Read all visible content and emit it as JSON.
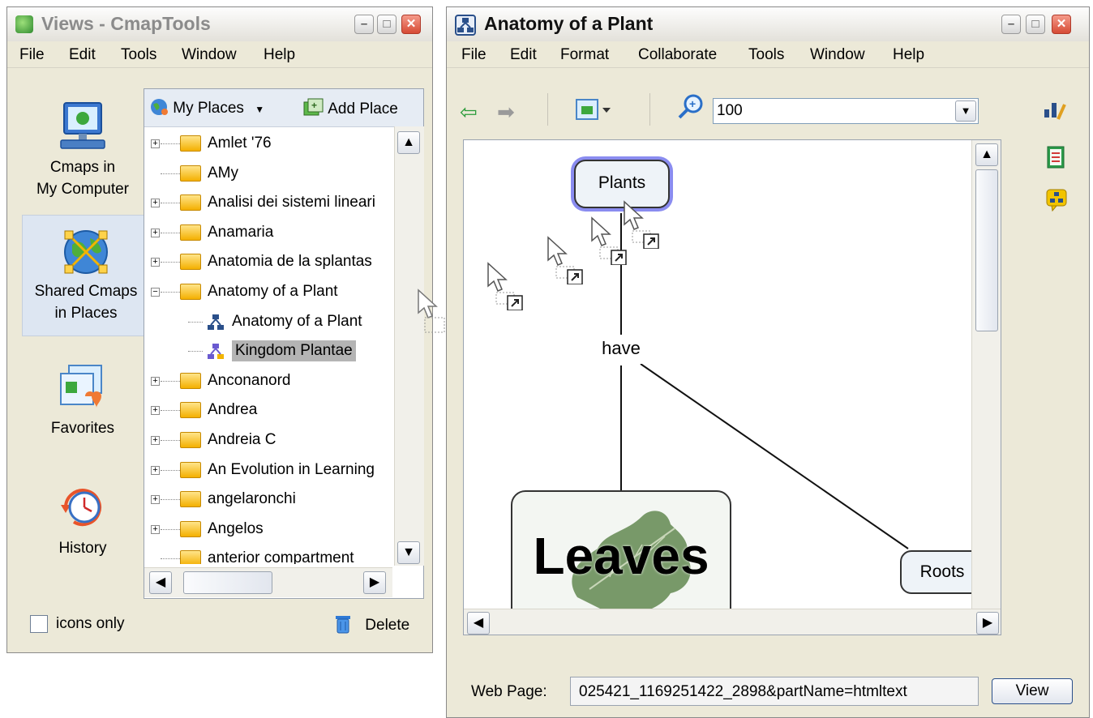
{
  "views_window": {
    "title": "Views - CmapTools",
    "menu": [
      "File",
      "Edit",
      "Tools",
      "Window",
      "Help"
    ],
    "nav": [
      {
        "label_line1": "Cmaps in",
        "label_line2": "My Computer",
        "icon": "computer-icon"
      },
      {
        "label_line1": "Shared Cmaps",
        "label_line2": "in Places",
        "icon": "globe-network-icon"
      },
      {
        "label_line1": "Favorites",
        "label_line2": "",
        "icon": "favorites-icon"
      },
      {
        "label_line1": "History",
        "label_line2": "",
        "icon": "history-clock-icon"
      }
    ],
    "places_button": "My Places",
    "add_place_button": "Add Place",
    "tree": [
      {
        "label": "Amlet '76",
        "type": "folder",
        "expander": "+"
      },
      {
        "label": "AMy",
        "type": "folder",
        "expander": ""
      },
      {
        "label": "Analisi dei sistemi lineari",
        "type": "folder",
        "expander": "+"
      },
      {
        "label": "Anamaria",
        "type": "folder",
        "expander": "+"
      },
      {
        "label": "Anatomia de la splantas",
        "type": "folder",
        "expander": "+"
      },
      {
        "label": "Anatomy of a Plant",
        "type": "folder-open",
        "expander": "−"
      },
      {
        "label": "Anatomy of a Plant",
        "type": "cmap",
        "expander": ""
      },
      {
        "label": "Kingdom Plantae",
        "type": "cmap-selected",
        "expander": ""
      },
      {
        "label": "Anconanord",
        "type": "folder",
        "expander": "+"
      },
      {
        "label": "Andrea",
        "type": "folder",
        "expander": "+"
      },
      {
        "label": "Andreia C",
        "type": "folder",
        "expander": "+"
      },
      {
        "label": "An Evolution in Learning",
        "type": "folder",
        "expander": "+"
      },
      {
        "label": "angelaronchi",
        "type": "folder",
        "expander": "+"
      },
      {
        "label": "Angelos",
        "type": "folder",
        "expander": "+"
      },
      {
        "label": "anterior compartment",
        "type": "folder",
        "expander": ""
      }
    ],
    "icons_only_label": "icons only",
    "delete_label": "Delete"
  },
  "cmap_window": {
    "title": "Anatomy of a Plant",
    "menu": [
      "File",
      "Edit",
      "Format",
      "Collaborate",
      "Tools",
      "Window",
      "Help"
    ],
    "zoom_value": "100",
    "concepts": {
      "plants": "Plants",
      "linking_phrase": "have",
      "leaves": "Leaves",
      "roots": "Roots"
    },
    "web_page_label": "Web Page:",
    "web_page_value": "025421_1169251422_2898&partName=htmltext",
    "view_button": "View"
  },
  "colors": {
    "selection_bg": "#b4b4b4",
    "node_highlight": "#8a8cf0",
    "window_bg": "#ece9d8"
  }
}
